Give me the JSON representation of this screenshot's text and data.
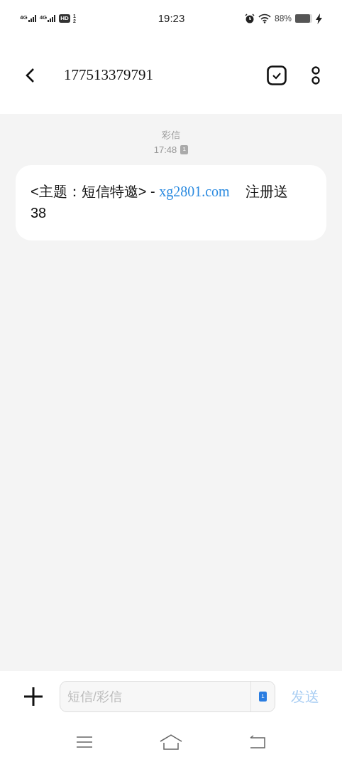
{
  "status_bar": {
    "networks": [
      "4G",
      "4G"
    ],
    "hd": "HD",
    "sims": [
      "1",
      "2"
    ],
    "time": "19:23",
    "battery": "88%"
  },
  "header": {
    "title": "177513379791"
  },
  "thread": {
    "type_label": "彩信",
    "time": "17:48",
    "sim": "1",
    "messages": [
      {
        "parts": [
          {
            "kind": "text",
            "text": "<主题：短信特邀> - "
          },
          {
            "kind": "link",
            "text": "xg2801.com"
          },
          {
            "kind": "text",
            "text": "    注册送38"
          }
        ]
      }
    ]
  },
  "composer": {
    "placeholder": "短信/彩信",
    "sim": "1",
    "send": "发送"
  }
}
